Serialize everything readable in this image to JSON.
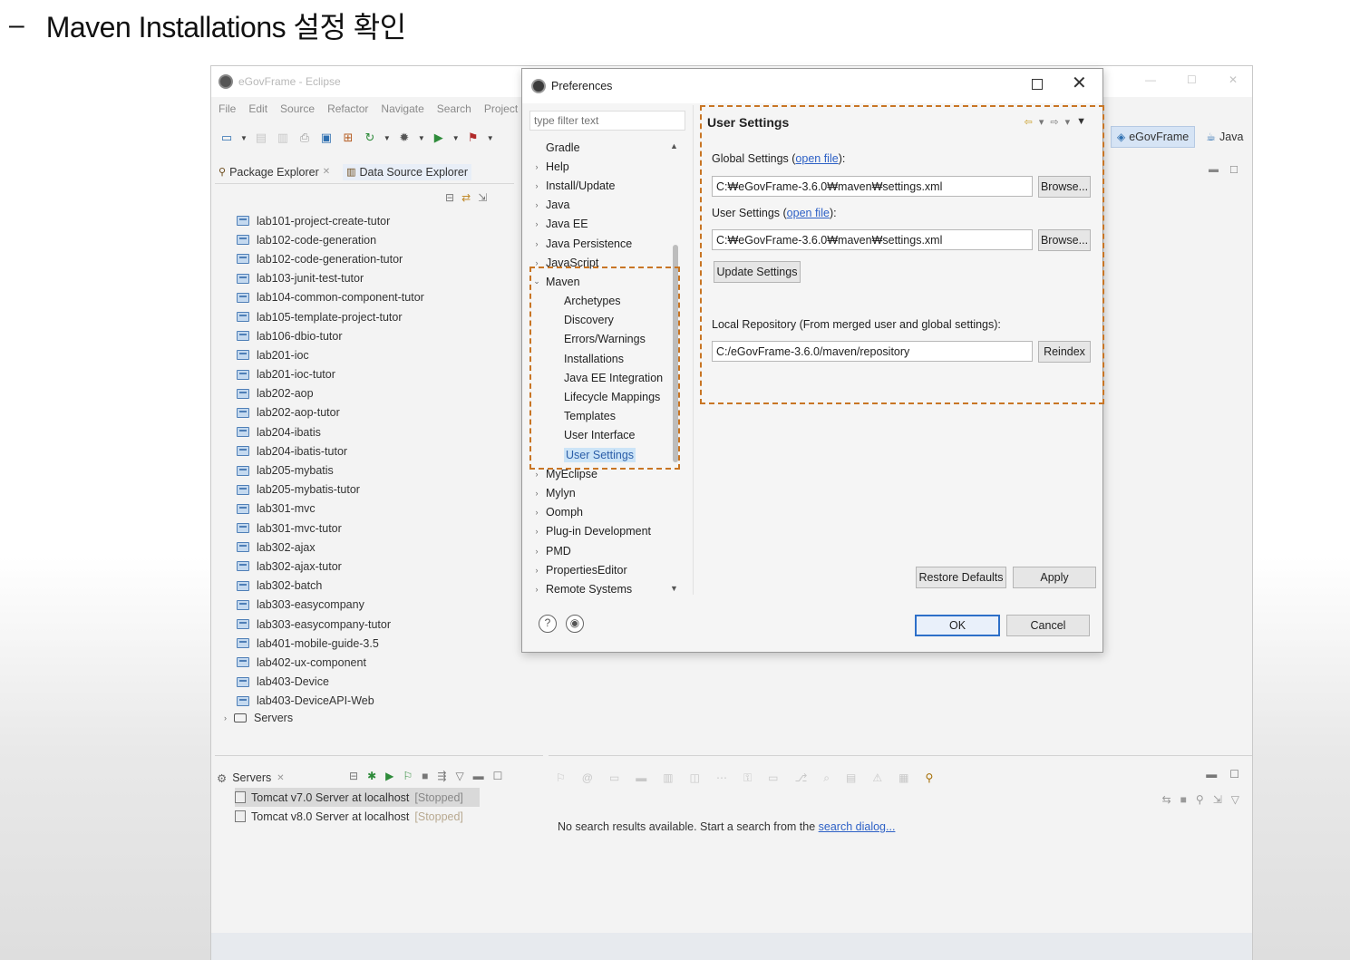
{
  "slide": {
    "dash": "–",
    "title": "Maven Installations 설정 확인"
  },
  "eclipse": {
    "title": "eGovFrame - Eclipse",
    "menu": [
      "File",
      "Edit",
      "Source",
      "Refactor",
      "Navigate",
      "Search",
      "Project"
    ],
    "window_controls": [
      "—",
      "☐",
      "✕"
    ],
    "tabs": {
      "package_explorer": "Package Explorer",
      "data_source_explorer": "Data Source Explorer"
    },
    "projects": [
      "lab101-project-create-tutor",
      "lab102-code-generation",
      "lab102-code-generation-tutor",
      "lab103-junit-test-tutor",
      "lab104-common-component-tutor",
      "lab105-template-project-tutor",
      "lab106-dbio-tutor",
      "lab201-ioc",
      "lab201-ioc-tutor",
      "lab202-aop",
      "lab202-aop-tutor",
      "lab204-ibatis",
      "lab204-ibatis-tutor",
      "lab205-mybatis",
      "lab205-mybatis-tutor",
      "lab301-mvc",
      "lab301-mvc-tutor",
      "lab302-ajax",
      "lab302-ajax-tutor",
      "lab302-batch",
      "lab303-easycompany",
      "lab303-easycompany-tutor",
      "lab401-mobile-guide-3.5",
      "lab402-ux-component",
      "lab403-Device",
      "lab403-DeviceAPI-Web"
    ],
    "servers_folder": "Servers",
    "servers_view": {
      "title": "Servers",
      "servers": [
        {
          "name": "Tomcat v7.0 Server at localhost",
          "status": "[Stopped]"
        },
        {
          "name": "Tomcat v8.0 Server at localhost",
          "status": "[Stopped]"
        }
      ]
    },
    "search_view": {
      "message": "No search results available. Start a search from the ",
      "link": "search dialog..."
    },
    "perspectives": {
      "egov": "eGovFrame",
      "java": "Java"
    }
  },
  "preferences": {
    "title": "Preferences",
    "filter_placeholder": "type filter text",
    "tree_top": [
      "Gradle",
      "Help",
      "Install/Update",
      "Java",
      "Java EE",
      "Java Persistence",
      "JavaScript"
    ],
    "maven": "Maven",
    "maven_children": [
      "Archetypes",
      "Discovery",
      "Errors/Warnings",
      "Installations",
      "Java EE Integration",
      "Lifecycle Mappings",
      "Templates",
      "User Interface",
      "User Settings"
    ],
    "tree_bottom": [
      "MyEclipse",
      "Mylyn",
      "Oomph",
      "Plug-in Development",
      "PMD",
      "PropertiesEditor",
      "Remote Systems"
    ],
    "page": {
      "title": "User Settings",
      "global_label": "Global Settings",
      "user_label": "User Settings",
      "open_file": "open file",
      "global_path": "C:₩eGovFrame-3.6.0₩maven₩settings.xml",
      "user_path": "C:₩eGovFrame-3.6.0₩maven₩settings.xml",
      "browse": "Browse...",
      "update_settings": "Update Settings",
      "local_repo_label": "Local Repository (From merged user and global settings):",
      "local_repo_path": "C:/eGovFrame-3.6.0/maven/repository",
      "reindex": "Reindex"
    },
    "buttons": {
      "restore_defaults": "Restore Defaults",
      "apply": "Apply",
      "ok": "OK",
      "cancel": "Cancel"
    }
  }
}
